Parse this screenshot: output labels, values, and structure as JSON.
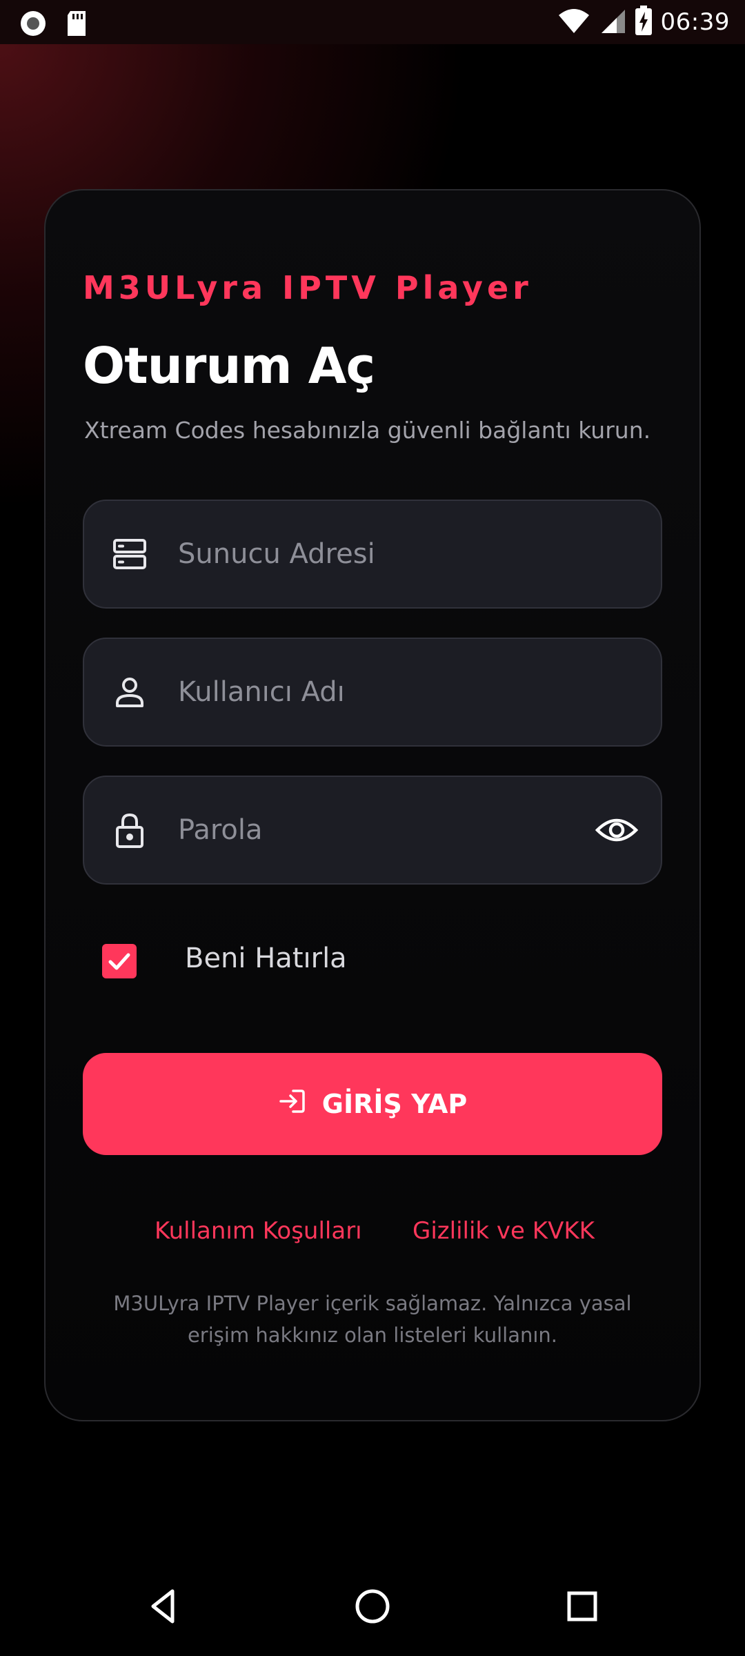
{
  "status_bar": {
    "time": "06:39",
    "left_icons": [
      "record-icon",
      "sd-card-icon"
    ],
    "right_icons": [
      "wifi-icon",
      "cell-signal-icon",
      "battery-charging-icon"
    ]
  },
  "login": {
    "brand": "M3ULyra IPTV Player",
    "title": "Oturum Aç",
    "subtitle": "Xtream Codes hesabınızla güvenli bağlantı kurun.",
    "fields": {
      "server": {
        "placeholder": "Sunucu Adresi",
        "icon": "server-icon"
      },
      "username": {
        "placeholder": "Kullanıcı Adı",
        "icon": "user-icon"
      },
      "password": {
        "placeholder": "Parola",
        "icon": "lock-icon",
        "toggle_icon": "eye-icon"
      }
    },
    "remember": {
      "label": "Beni Hatırla",
      "checked": true
    },
    "submit": {
      "label": "GİRİŞ YAP",
      "icon": "login-icon"
    },
    "links": {
      "terms": "Kullanım Koşulları",
      "privacy": "Gizlilik ve KVKK"
    },
    "disclaimer": "M3ULyra IPTV Player içerik sağlamaz. Yalnızca yasal erişim hakkınız olan listeleri kullanın."
  },
  "colors": {
    "accent": "#ff375b",
    "field_bg": "#1c1d24",
    "text_muted": "#8e8f98"
  },
  "nav_bar": {
    "icons": [
      "back-icon",
      "home-icon",
      "recents-icon"
    ]
  }
}
